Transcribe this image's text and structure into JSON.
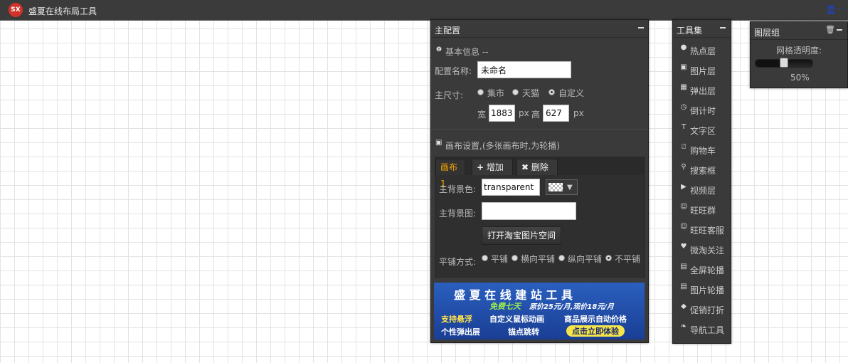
{
  "app": {
    "logo_text": "SX",
    "title": "盛夏在线布局工具",
    "top_link": "登",
    "top_dots": "..."
  },
  "main_panel": {
    "title": "主配置",
    "basic_info": "基本信息 --",
    "name_label": "配置名称:",
    "name_value": "未命名",
    "size_label": "主尺寸:",
    "size_options": [
      "集市",
      "天猫",
      "自定义"
    ],
    "size_selected": "自定义",
    "width_label": "宽",
    "width_value": "1883",
    "px1": "px",
    "height_label": "高",
    "height_value": "627",
    "px2": "px",
    "canvas_settings": "画布设置,(多张画布时,为轮播)",
    "tabs": {
      "canvas1": "画布1",
      "add": "增加",
      "delete": "删除"
    },
    "bg_color_label": "主背景色:",
    "bg_color_value": "transparent",
    "bg_image_label": "主背景图:",
    "bg_image_value": "",
    "open_space_button": "打开淘宝图片空间",
    "tile_label": "平铺方式:",
    "tile_options": [
      "平铺",
      "横向平铺",
      "纵向平铺",
      "不平铺"
    ],
    "tile_selected": "不平铺",
    "banner": {
      "line1": "盛 夏 在 线 建 站 工 具",
      "free": "免费七天",
      "price": "原价25元/月,现价18元/月",
      "f1": "支持悬浮",
      "f2": "自定义鼠标动画",
      "f3": "商品展示自动价格",
      "f4": "个性弹出层",
      "f5": "锚点跳转",
      "cta": "点击立即体验"
    }
  },
  "tools_panel": {
    "title": "工具集",
    "items": [
      {
        "label": "热点层",
        "icon": "dot-icon"
      },
      {
        "label": "图片层",
        "icon": "picture-icon"
      },
      {
        "label": "弹出层",
        "icon": "grid-icon"
      },
      {
        "label": "倒计时",
        "icon": "clock-icon"
      },
      {
        "label": "文字区",
        "icon": "text-icon"
      },
      {
        "label": "购物车",
        "icon": "cart-icon"
      },
      {
        "label": "搜索框",
        "icon": "search-icon"
      },
      {
        "label": "视频层",
        "icon": "play-icon"
      },
      {
        "label": "旺旺群",
        "icon": "user-icon"
      },
      {
        "label": "旺旺客服",
        "icon": "user-icon"
      },
      {
        "label": "微淘关注",
        "icon": "heart-icon"
      },
      {
        "label": "全屏轮播",
        "icon": "film-icon"
      },
      {
        "label": "图片轮播",
        "icon": "film-icon"
      },
      {
        "label": "促销打折",
        "icon": "tag-icon"
      },
      {
        "label": "导航工具",
        "icon": "leaf-icon"
      }
    ]
  },
  "layers_panel": {
    "title": "图层组",
    "grid_opacity_label": "网格透明度:",
    "grid_opacity_value": "50%",
    "grid_opacity_fraction": 0.5
  }
}
